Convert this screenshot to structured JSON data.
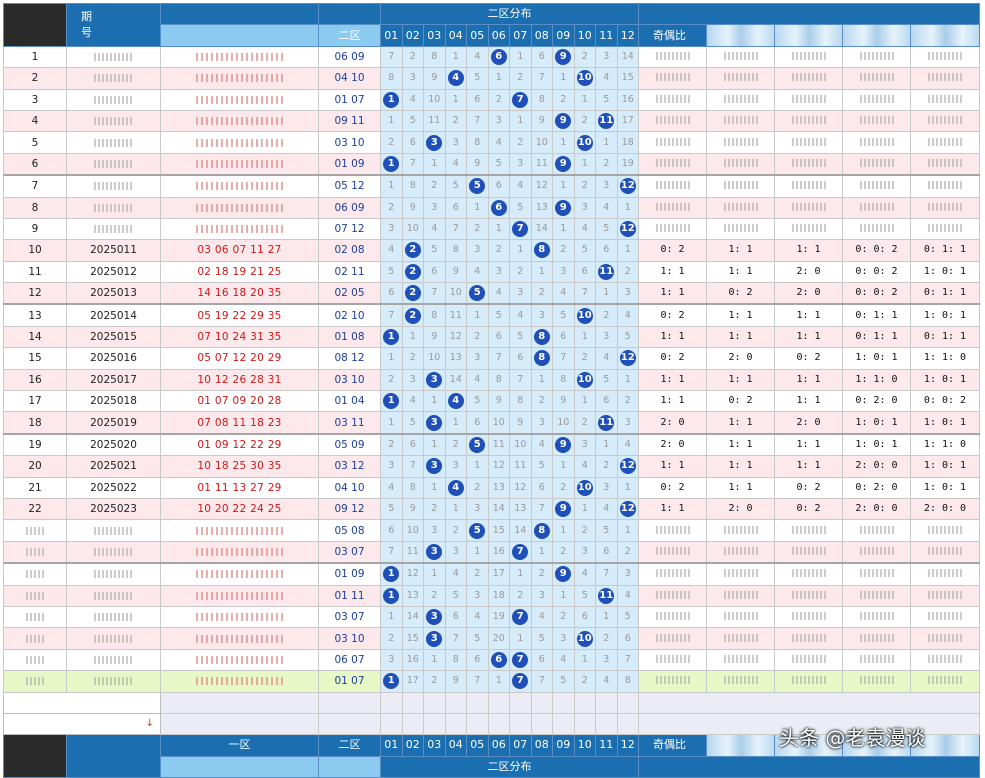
{
  "header": {
    "period_label": "期\n号",
    "zone1": "一区",
    "zone2": "二区",
    "zone2_dist": "二区分布",
    "odd_even": "奇偶比",
    "numbers": [
      "01",
      "02",
      "03",
      "04",
      "05",
      "06",
      "07",
      "08",
      "09",
      "10",
      "11",
      "12"
    ]
  },
  "rows": [
    {
      "idx": "1",
      "period": "",
      "reds": "",
      "blues": "06 09",
      "dist": [
        "7",
        "2",
        "8",
        "1",
        "4",
        "6",
        "1",
        "6",
        "9",
        "2",
        "3",
        "14"
      ],
      "balls": [
        6,
        9
      ],
      "r": [
        "",
        "",
        "",
        "",
        ""
      ]
    },
    {
      "idx": "2",
      "period": "",
      "reds": "",
      "blues": "04 10",
      "dist": [
        "8",
        "3",
        "9",
        "4",
        "5",
        "1",
        "2",
        "7",
        "1",
        "10",
        "4",
        "15"
      ],
      "balls": [
        4,
        10
      ],
      "r": [
        "",
        "",
        "",
        "",
        ""
      ]
    },
    {
      "idx": "3",
      "period": "",
      "reds": "",
      "blues": "01 07",
      "dist": [
        "1",
        "4",
        "10",
        "1",
        "6",
        "2",
        "7",
        "8",
        "2",
        "1",
        "5",
        "16"
      ],
      "balls": [
        1,
        7
      ],
      "r": [
        "",
        "",
        "",
        "",
        ""
      ]
    },
    {
      "idx": "4",
      "period": "",
      "reds": "",
      "blues": "09 11",
      "dist": [
        "1",
        "5",
        "11",
        "2",
        "7",
        "3",
        "1",
        "9",
        "9",
        "2",
        "11",
        "17"
      ],
      "balls": [
        9,
        11
      ],
      "r": [
        "",
        "",
        "",
        "",
        ""
      ]
    },
    {
      "idx": "5",
      "period": "",
      "reds": "",
      "blues": "03 10",
      "dist": [
        "2",
        "6",
        "3",
        "3",
        "8",
        "4",
        "2",
        "10",
        "1",
        "10",
        "1",
        "18"
      ],
      "balls": [
        3,
        10
      ],
      "r": [
        "",
        "",
        "",
        "",
        ""
      ]
    },
    {
      "idx": "6",
      "period": "",
      "reds": "",
      "blues": "01 09",
      "dist": [
        "1",
        "7",
        "1",
        "4",
        "9",
        "5",
        "3",
        "11",
        "9",
        "1",
        "2",
        "19"
      ],
      "balls": [
        1,
        9
      ],
      "r": [
        "",
        "",
        "",
        "",
        ""
      ]
    },
    {
      "idx": "7",
      "period": "",
      "reds": "",
      "blues": "05 12",
      "dist": [
        "1",
        "8",
        "2",
        "5",
        "5",
        "6",
        "4",
        "12",
        "1",
        "2",
        "3",
        "12"
      ],
      "balls": [
        5,
        12
      ],
      "r": [
        "",
        "",
        "",
        "",
        ""
      ]
    },
    {
      "idx": "8",
      "period": "",
      "reds": "",
      "blues": "06 09",
      "dist": [
        "2",
        "9",
        "3",
        "6",
        "1",
        "6",
        "5",
        "13",
        "9",
        "3",
        "4",
        "1"
      ],
      "balls": [
        6,
        9
      ],
      "r": [
        "",
        "",
        "",
        "",
        ""
      ]
    },
    {
      "idx": "9",
      "period": "",
      "reds": "",
      "blues": "07 12",
      "dist": [
        "3",
        "10",
        "4",
        "7",
        "2",
        "1",
        "7",
        "14",
        "1",
        "4",
        "5",
        "12"
      ],
      "balls": [
        7,
        12
      ],
      "r": [
        "",
        "",
        "",
        "",
        ""
      ]
    },
    {
      "idx": "10",
      "period": "2025011",
      "reds": "03 06 07 11 27",
      "blues": "02 08",
      "dist": [
        "4",
        "2",
        "5",
        "8",
        "3",
        "2",
        "1",
        "8",
        "2",
        "5",
        "6",
        "1"
      ],
      "balls": [
        2,
        8
      ],
      "r": [
        "0: 2",
        "1: 1",
        "1: 1",
        "0: 0: 2",
        "0: 1: 1"
      ]
    },
    {
      "idx": "11",
      "period": "2025012",
      "reds": "02 18 19 21 25",
      "blues": "02 11",
      "dist": [
        "5",
        "2",
        "6",
        "9",
        "4",
        "3",
        "2",
        "1",
        "3",
        "6",
        "11",
        "2"
      ],
      "balls": [
        2,
        11
      ],
      "r": [
        "1: 1",
        "1: 1",
        "2: 0",
        "0: 0: 2",
        "1: 0: 1"
      ]
    },
    {
      "idx": "12",
      "period": "2025013",
      "reds": "14 16 18 20 35",
      "blues": "02 05",
      "dist": [
        "6",
        "2",
        "7",
        "10",
        "5",
        "4",
        "3",
        "2",
        "4",
        "7",
        "1",
        "3"
      ],
      "balls": [
        2,
        5
      ],
      "r": [
        "1: 1",
        "0: 2",
        "2: 0",
        "0: 0: 2",
        "0: 1: 1"
      ]
    },
    {
      "idx": "13",
      "period": "2025014",
      "reds": "05 19 22 29 35",
      "blues": "02 10",
      "dist": [
        "7",
        "2",
        "8",
        "11",
        "1",
        "5",
        "4",
        "3",
        "5",
        "10",
        "2",
        "4"
      ],
      "balls": [
        2,
        10
      ],
      "r": [
        "0: 2",
        "1: 1",
        "1: 1",
        "0: 1: 1",
        "1: 0: 1"
      ]
    },
    {
      "idx": "14",
      "period": "2025015",
      "reds": "07 10 24 31 35",
      "blues": "01 08",
      "dist": [
        "1",
        "1",
        "9",
        "12",
        "2",
        "6",
        "5",
        "8",
        "6",
        "1",
        "3",
        "5"
      ],
      "balls": [
        1,
        8
      ],
      "r": [
        "1: 1",
        "1: 1",
        "1: 1",
        "0: 1: 1",
        "0: 1: 1"
      ]
    },
    {
      "idx": "15",
      "period": "2025016",
      "reds": "05 07 12 20 29",
      "blues": "08 12",
      "dist": [
        "1",
        "2",
        "10",
        "13",
        "3",
        "7",
        "6",
        "8",
        "7",
        "2",
        "4",
        "12"
      ],
      "balls": [
        8,
        12
      ],
      "r": [
        "0: 2",
        "2: 0",
        "0: 2",
        "1: 0: 1",
        "1: 1: 0"
      ]
    },
    {
      "idx": "16",
      "period": "2025017",
      "reds": "10 12 26 28 31",
      "blues": "03 10",
      "dist": [
        "2",
        "3",
        "3",
        "14",
        "4",
        "8",
        "7",
        "1",
        "8",
        "10",
        "5",
        "1"
      ],
      "balls": [
        3,
        10
      ],
      "r": [
        "1: 1",
        "1: 1",
        "1: 1",
        "1: 1: 0",
        "1: 0: 1"
      ]
    },
    {
      "idx": "17",
      "period": "2025018",
      "reds": "01 07 09 20 28",
      "blues": "01 04",
      "dist": [
        "1",
        "4",
        "1",
        "4",
        "5",
        "9",
        "8",
        "2",
        "9",
        "1",
        "6",
        "2"
      ],
      "balls": [
        1,
        4
      ],
      "r": [
        "1: 1",
        "0: 2",
        "1: 1",
        "0: 2: 0",
        "0: 0: 2"
      ]
    },
    {
      "idx": "18",
      "period": "2025019",
      "reds": "07 08 11 18 23",
      "blues": "03 11",
      "dist": [
        "1",
        "5",
        "3",
        "1",
        "6",
        "10",
        "9",
        "3",
        "10",
        "2",
        "11",
        "3"
      ],
      "balls": [
        3,
        11
      ],
      "r": [
        "2: 0",
        "1: 1",
        "2: 0",
        "1: 0: 1",
        "1: 0: 1"
      ]
    },
    {
      "idx": "19",
      "period": "2025020",
      "reds": "01 09 12 22 29",
      "blues": "05 09",
      "dist": [
        "2",
        "6",
        "1",
        "2",
        "5",
        "11",
        "10",
        "4",
        "9",
        "3",
        "1",
        "4"
      ],
      "balls": [
        5,
        9
      ],
      "r": [
        "2: 0",
        "1: 1",
        "1: 1",
        "1: 0: 1",
        "1: 1: 0"
      ]
    },
    {
      "idx": "20",
      "period": "2025021",
      "reds": "10 18 25 30 35",
      "blues": "03 12",
      "dist": [
        "3",
        "7",
        "3",
        "3",
        "1",
        "12",
        "11",
        "5",
        "1",
        "4",
        "2",
        "12"
      ],
      "balls": [
        3,
        12
      ],
      "r": [
        "1: 1",
        "1: 1",
        "1: 1",
        "2: 0: 0",
        "1: 0: 1"
      ]
    },
    {
      "idx": "21",
      "period": "2025022",
      "reds": "01 11 13 27 29",
      "blues": "04 10",
      "dist": [
        "4",
        "8",
        "1",
        "4",
        "2",
        "13",
        "12",
        "6",
        "2",
        "10",
        "3",
        "1"
      ],
      "balls": [
        4,
        10
      ],
      "r": [
        "0: 2",
        "1: 1",
        "0: 2",
        "0: 2: 0",
        "1: 0: 1"
      ]
    },
    {
      "idx": "22",
      "period": "2025023",
      "reds": "10 20 22 24 25",
      "blues": "09 12",
      "dist": [
        "5",
        "9",
        "2",
        "1",
        "3",
        "14",
        "13",
        "7",
        "9",
        "1",
        "4",
        "12"
      ],
      "balls": [
        9,
        12
      ],
      "r": [
        "1: 1",
        "2: 0",
        "0: 2",
        "2: 0: 0",
        "2: 0: 0"
      ]
    },
    {
      "idx": "",
      "period": "",
      "reds": "",
      "blues": "05 08",
      "dist": [
        "6",
        "10",
        "3",
        "2",
        "5",
        "15",
        "14",
        "8",
        "1",
        "2",
        "5",
        "1"
      ],
      "balls": [
        5,
        8
      ],
      "r": [
        "",
        "",
        "",
        "",
        ""
      ]
    },
    {
      "idx": "",
      "period": "",
      "reds": "",
      "blues": "03 07",
      "dist": [
        "7",
        "11",
        "3",
        "3",
        "1",
        "16",
        "7",
        "1",
        "2",
        "3",
        "6",
        "2"
      ],
      "balls": [
        3,
        7
      ],
      "r": [
        "",
        "",
        "",
        "",
        ""
      ]
    },
    {
      "idx": "",
      "period": "",
      "reds": "",
      "blues": "01 09",
      "dist": [
        "1",
        "12",
        "1",
        "4",
        "2",
        "17",
        "1",
        "2",
        "9",
        "4",
        "7",
        "3"
      ],
      "balls": [
        1,
        9
      ],
      "r": [
        "",
        "",
        "",
        "",
        ""
      ]
    },
    {
      "idx": "",
      "period": "",
      "reds": "",
      "blues": "01 11",
      "dist": [
        "1",
        "13",
        "2",
        "5",
        "3",
        "18",
        "2",
        "3",
        "1",
        "5",
        "11",
        "4"
      ],
      "balls": [
        1,
        11
      ],
      "r": [
        "",
        "",
        "",
        "",
        ""
      ]
    },
    {
      "idx": "",
      "period": "",
      "reds": "",
      "blues": "03 07",
      "dist": [
        "1",
        "14",
        "3",
        "6",
        "4",
        "19",
        "7",
        "4",
        "2",
        "6",
        "1",
        "5"
      ],
      "balls": [
        3,
        7
      ],
      "r": [
        "",
        "",
        "",
        "",
        ""
      ]
    },
    {
      "idx": "",
      "period": "",
      "reds": "",
      "blues": "03 10",
      "dist": [
        "2",
        "15",
        "3",
        "7",
        "5",
        "20",
        "1",
        "5",
        "3",
        "10",
        "2",
        "6"
      ],
      "balls": [
        3,
        10
      ],
      "r": [
        "",
        "",
        "",
        "",
        ""
      ]
    },
    {
      "idx": "",
      "period": "",
      "reds": "",
      "blues": "06 07",
      "dist": [
        "3",
        "16",
        "1",
        "8",
        "6",
        "6",
        "7",
        "6",
        "4",
        "1",
        "3",
        "7"
      ],
      "balls": [
        6,
        7
      ],
      "r": [
        "",
        "",
        "",
        "",
        ""
      ]
    },
    {
      "idx": "",
      "period": "",
      "reds": "",
      "blues": "01 07",
      "dist": [
        "1",
        "17",
        "2",
        "9",
        "7",
        "1",
        "7",
        "7",
        "5",
        "2",
        "4",
        "8"
      ],
      "balls": [
        1,
        7
      ],
      "r": [
        "",
        "",
        "",
        "",
        ""
      ]
    }
  ],
  "watermark": "头条 @老袁漫谈",
  "arrow": "↓"
}
